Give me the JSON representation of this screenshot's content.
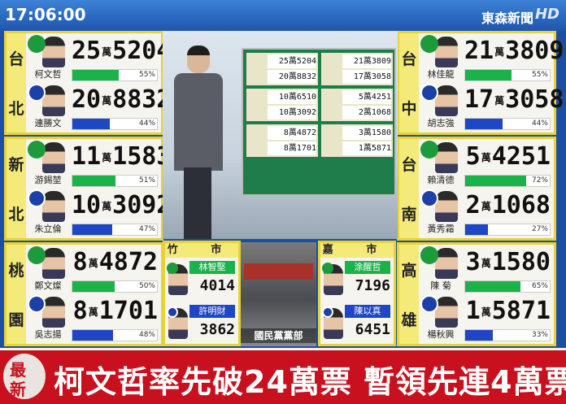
{
  "header": {
    "clock": "17:06:00",
    "channel": "東森新聞",
    "hd": "HD"
  },
  "wan": "萬",
  "races": [
    {
      "city": [
        "台",
        "北"
      ],
      "candidates": [
        {
          "name": "柯文哲",
          "party": "dpp",
          "wan": "25",
          "rest": "5204",
          "pct_text": "55%",
          "pct": 55
        },
        {
          "name": "連勝文",
          "party": "kmt",
          "wan": "20",
          "rest": "8832",
          "pct_text": "44%",
          "pct": 44
        }
      ]
    },
    {
      "city": [
        "新",
        "北"
      ],
      "candidates": [
        {
          "name": "游錫堃",
          "party": "dpp",
          "wan": "11",
          "rest": "1583",
          "pct_text": "51%",
          "pct": 51
        },
        {
          "name": "朱立倫",
          "party": "kmt",
          "wan": "10",
          "rest": "3092",
          "pct_text": "47%",
          "pct": 47
        }
      ]
    },
    {
      "city": [
        "桃",
        "園"
      ],
      "candidates": [
        {
          "name": "鄭文燦",
          "party": "dpp",
          "wan": "8",
          "rest": "4872",
          "pct_text": "50%",
          "pct": 50
        },
        {
          "name": "吳志揚",
          "party": "kmt",
          "wan": "8",
          "rest": "1701",
          "pct_text": "48%",
          "pct": 48
        }
      ]
    },
    {
      "city": [
        "台",
        "中"
      ],
      "candidates": [
        {
          "name": "林佳龍",
          "party": "dpp",
          "wan": "21",
          "rest": "3809",
          "pct_text": "55%",
          "pct": 55
        },
        {
          "name": "胡志強",
          "party": "kmt",
          "wan": "17",
          "rest": "3058",
          "pct_text": "44%",
          "pct": 44
        }
      ]
    },
    {
      "city": [
        "台",
        "南"
      ],
      "candidates": [
        {
          "name": "賴清德",
          "party": "dpp",
          "wan": "5",
          "rest": "4251",
          "pct_text": "72%",
          "pct": 72
        },
        {
          "name": "黃秀霜",
          "party": "kmt",
          "wan": "2",
          "rest": "1068",
          "pct_text": "27%",
          "pct": 27
        }
      ]
    },
    {
      "city": [
        "高",
        "雄"
      ],
      "candidates": [
        {
          "name": "陳 菊",
          "party": "dpp",
          "wan": "3",
          "rest": "1580",
          "pct_text": "65%",
          "pct": 65
        },
        {
          "name": "楊秋興",
          "party": "kmt",
          "wan": "1",
          "rest": "5871",
          "pct_text": "33%",
          "pct": 33
        }
      ]
    }
  ],
  "mid_races": [
    {
      "title": "竹 市",
      "candidates": [
        {
          "name": "林智堅",
          "party": "dpp",
          "votes": "4014"
        },
        {
          "name": "許明財",
          "party": "kmt",
          "votes": "3862"
        }
      ]
    },
    {
      "title": "嘉 市",
      "candidates": [
        {
          "name": "涂醒哲",
          "party": "dpp",
          "votes": "7196"
        },
        {
          "name": "陳以真",
          "party": "kmt",
          "votes": "6451"
        }
      ]
    }
  ],
  "studio_screen": [
    {
      "top": "25萬5204",
      "bottom": "20萬8832"
    },
    {
      "top": "21萬3809",
      "bottom": "17萬3058"
    },
    {
      "top": "10萬6510",
      "bottom": "10萬3092"
    },
    {
      "top": "5萬4251",
      "bottom": "2萬1068"
    },
    {
      "top": "8萬4872",
      "bottom": "8萬1701"
    },
    {
      "top": "3萬1580",
      "bottom": "1萬5871"
    }
  ],
  "photo_caption": "國民黨黨部",
  "ticker": {
    "badge_top": "最",
    "badge_bottom": "新",
    "headline": "柯文哲率先破24萬票 暫領先連4萬票"
  }
}
